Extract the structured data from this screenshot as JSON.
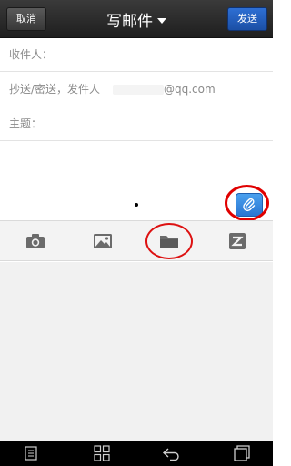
{
  "header": {
    "cancel_label": "取消",
    "title": "写邮件",
    "send_label": "发送"
  },
  "fields": {
    "to_label": "收件人：",
    "cc_label": "抄送/密送，发件人",
    "cc_sender_domain": "@qq.com",
    "subject_label": "主题："
  },
  "toolbar": {
    "items": [
      "camera-icon",
      "image-icon",
      "folder-icon",
      "zip-icon"
    ]
  },
  "navbar": {
    "items": [
      "menu-icon",
      "apps-icon",
      "back-icon",
      "recent-apps-icon"
    ]
  },
  "colors": {
    "send_button": "#1b4fa5",
    "attach_button": "#2a76d2",
    "highlight_circle": "#e00000"
  }
}
